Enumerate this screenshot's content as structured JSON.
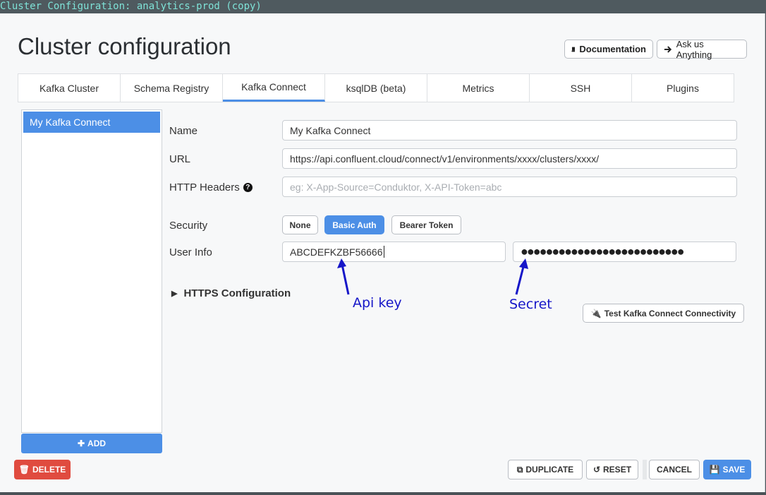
{
  "window_title": "Cluster Configuration: analytics-prod (copy)",
  "page_title": "Cluster configuration",
  "header_buttons": {
    "documentation": "Documentation",
    "ask": "Ask us Anything"
  },
  "tabs": [
    {
      "label": "Kafka Cluster",
      "active": false
    },
    {
      "label": "Schema Registry",
      "active": false
    },
    {
      "label": "Kafka Connect",
      "active": true
    },
    {
      "label": "ksqlDB (beta)",
      "active": false
    },
    {
      "label": "Metrics",
      "active": false
    },
    {
      "label": "SSH",
      "active": false
    },
    {
      "label": "Plugins",
      "active": false
    }
  ],
  "sidebar": {
    "items": [
      "My Kafka Connect"
    ],
    "add_label": "ADD"
  },
  "form": {
    "name_label": "Name",
    "name_value": "My Kafka Connect",
    "url_label": "URL",
    "url_value": "https://api.confluent.cloud/connect/v1/environments/xxxx/clusters/xxxx/",
    "headers_label": "HTTP Headers",
    "headers_placeholder": "eg: X-App-Source=Conduktor, X-API-Token=abc",
    "security_label": "Security",
    "security_options": [
      "None",
      "Basic Auth",
      "Bearer Token"
    ],
    "security_selected": "Basic Auth",
    "userinfo_label": "User Info",
    "userinfo_key": "ABCDEFKZBF56666",
    "userinfo_secret_masked": "●●●●●●●●●●●●●●●●●●●●●●●●●●",
    "https_label": "HTTPS Configuration",
    "test_label": "Test Kafka Connect Connectivity"
  },
  "annotations": {
    "api_key": "Api key",
    "secret": "Secret"
  },
  "footer": {
    "delete": "DELETE",
    "duplicate": "DUPLICATE",
    "reset": "RESET",
    "cancel": "CANCEL",
    "save": "SAVE"
  },
  "colors": {
    "accent": "#4c8fe6",
    "danger": "#e04b3f",
    "annotation": "#1616c8",
    "title_text": "#7fe3d8"
  }
}
